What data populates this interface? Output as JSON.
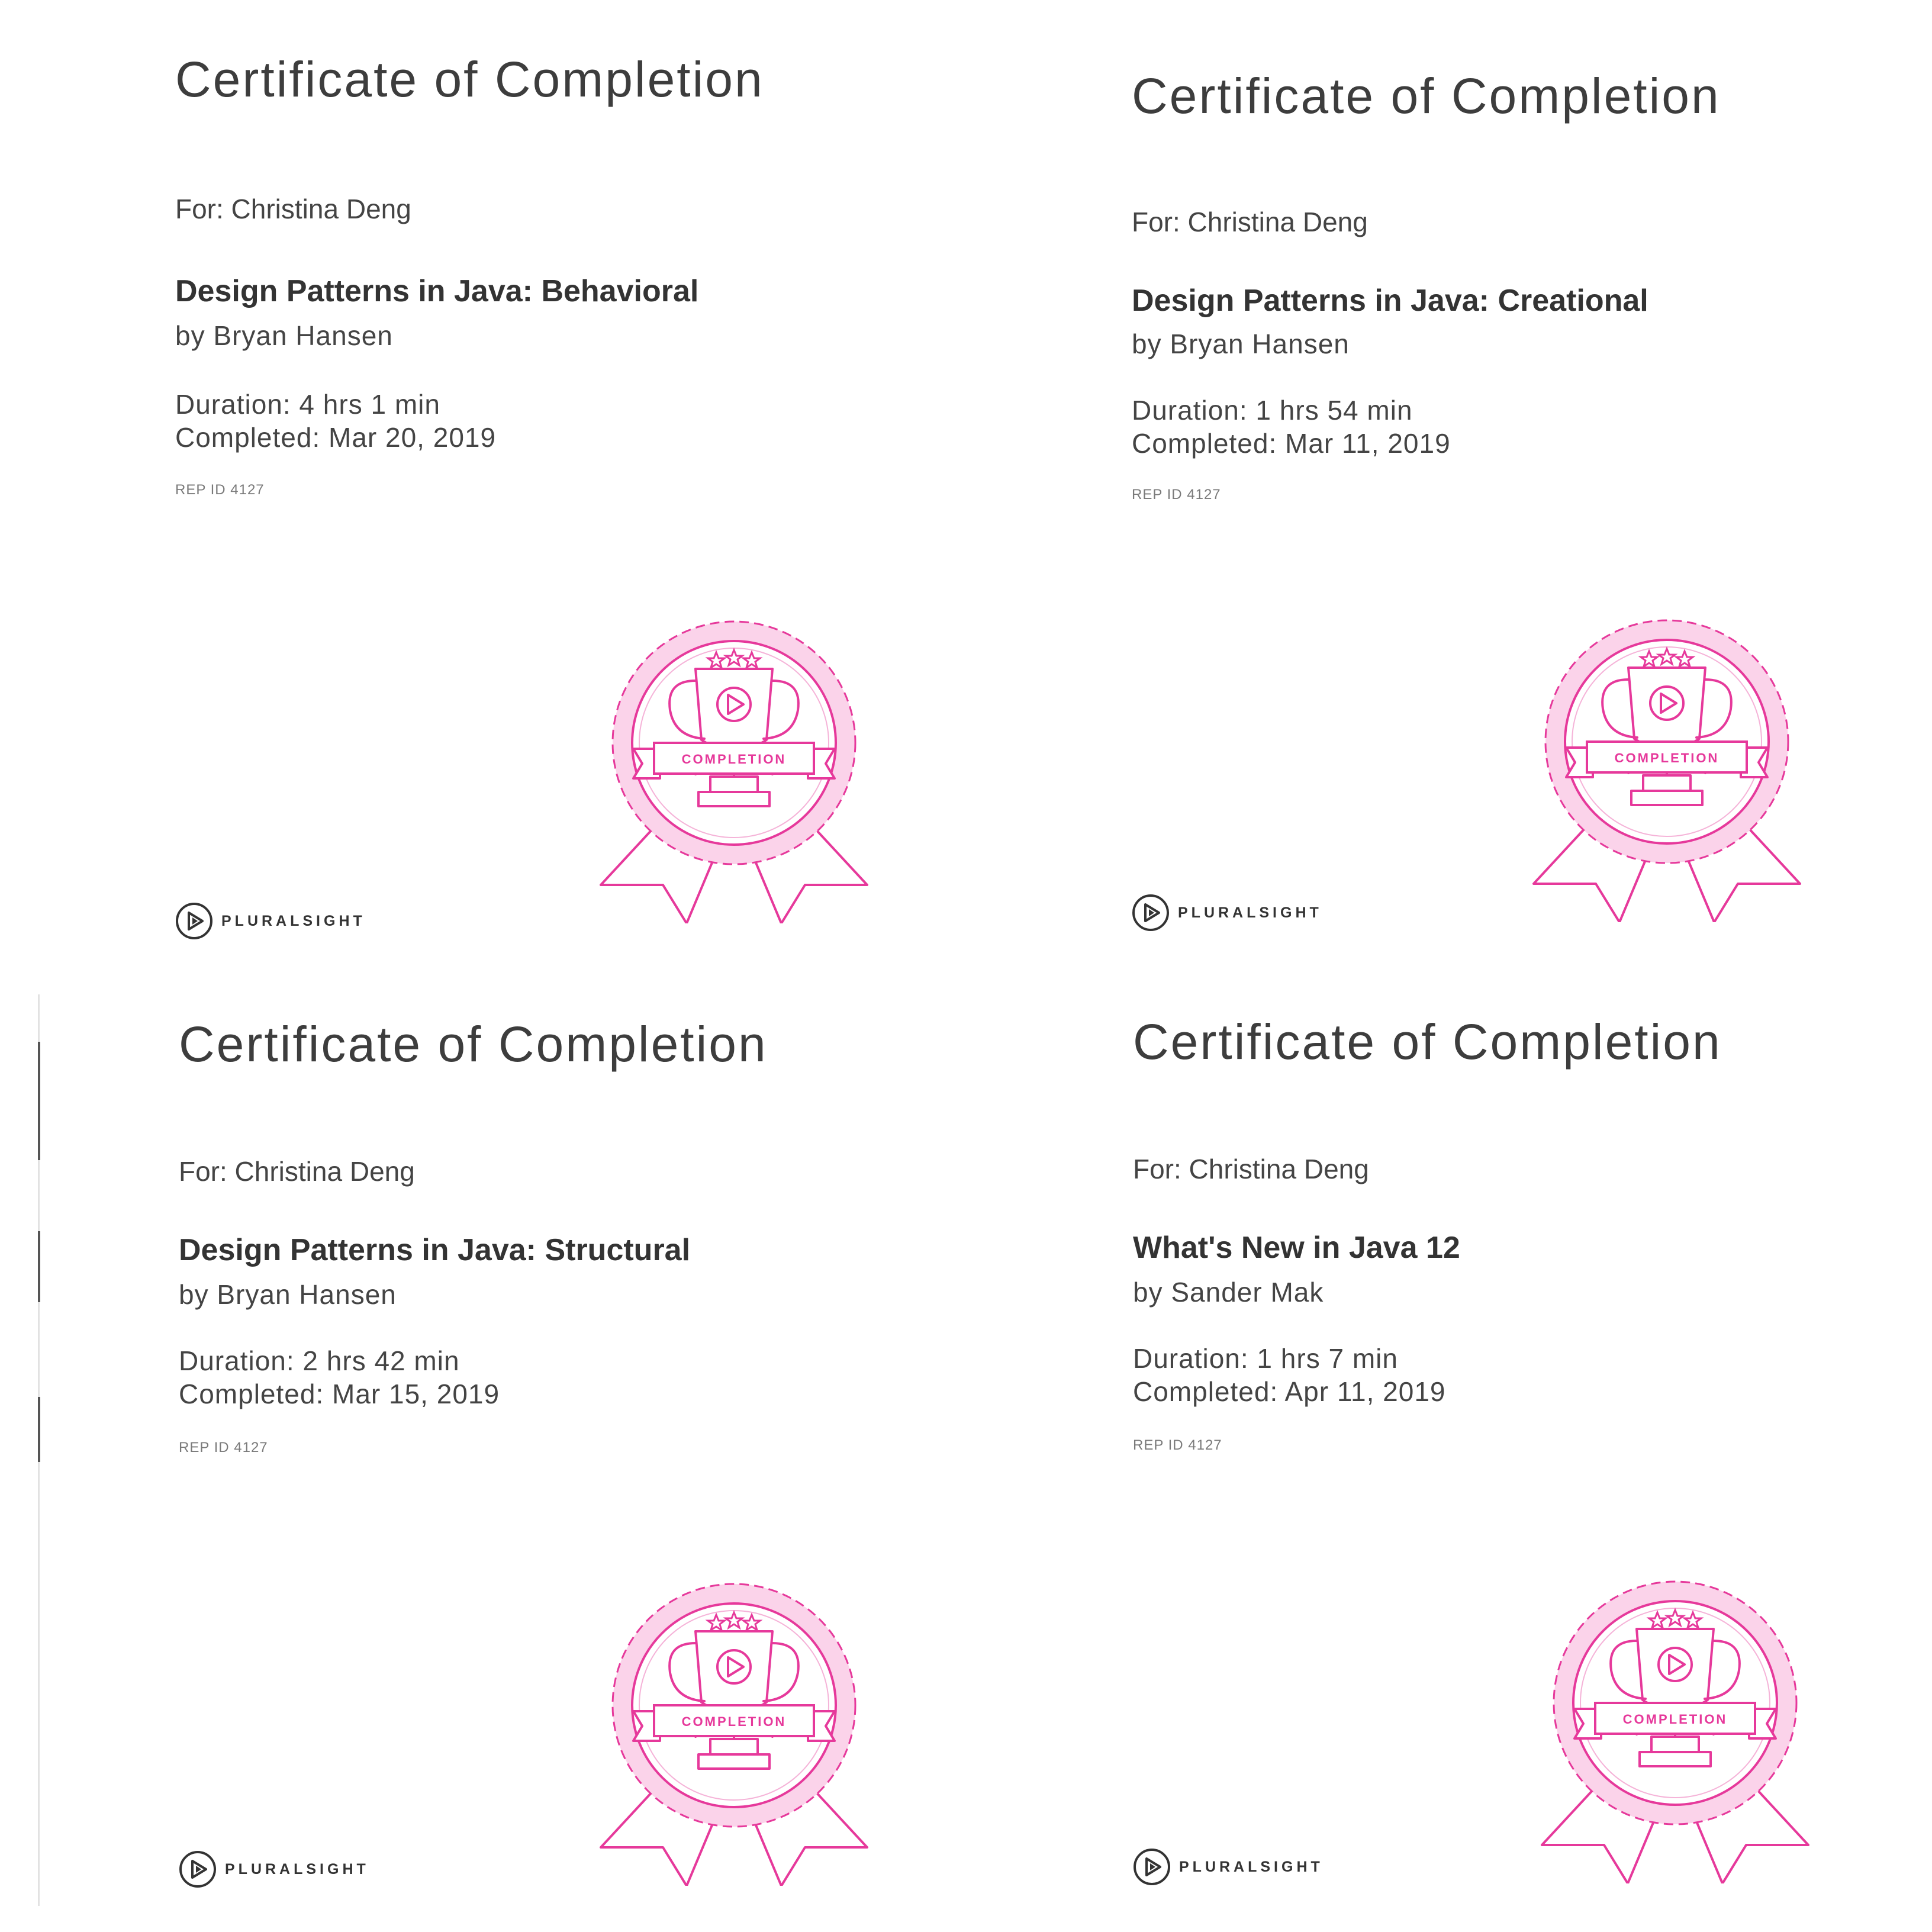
{
  "certificates": [
    {
      "title": "Certificate of Completion",
      "recipient": "For: Christina Deng",
      "course": "Design Patterns in Java: Behavioral",
      "author": "by Bryan Hansen",
      "duration": "Duration: 4 hrs 1 min",
      "completed": "Completed: Mar 20, 2019",
      "rep_id": "REP ID 4127",
      "badge_label": "COMPLETION",
      "brand": "PLURALSIGHT"
    },
    {
      "title": "Certificate of Completion",
      "recipient": "For: Christina Deng",
      "course": "Design Patterns in Java: Creational",
      "author": "by Bryan Hansen",
      "duration": "Duration: 1 hrs 54 min",
      "completed": "Completed: Mar 11, 2019",
      "rep_id": "REP ID 4127",
      "badge_label": "COMPLETION",
      "brand": "PLURALSIGHT"
    },
    {
      "title": "Certificate of Completion",
      "recipient": "For: Christina Deng",
      "course": "Design Patterns in Java: Structural",
      "author": "by Bryan Hansen",
      "duration": "Duration: 2 hrs 42 min",
      "completed": "Completed: Mar 15, 2019",
      "rep_id": "REP ID 4127",
      "badge_label": "COMPLETION",
      "brand": "PLURALSIGHT"
    },
    {
      "title": "Certificate of Completion",
      "recipient": "For: Christina Deng",
      "course": "What's New in Java 12",
      "author": "by Sander Mak",
      "duration": "Duration: 1 hrs 7 min",
      "completed": "Completed: Apr 11, 2019",
      "rep_id": "REP ID 4127",
      "badge_label": "COMPLETION",
      "brand": "PLURALSIGHT"
    }
  ],
  "colors": {
    "badge_pink": "#e6399b",
    "badge_halo": "#fbd3ea",
    "text": "#3d3d3d"
  },
  "icons": {
    "badge": "completion-trophy-rosette-icon",
    "logo": "pluralsight-play-icon"
  }
}
